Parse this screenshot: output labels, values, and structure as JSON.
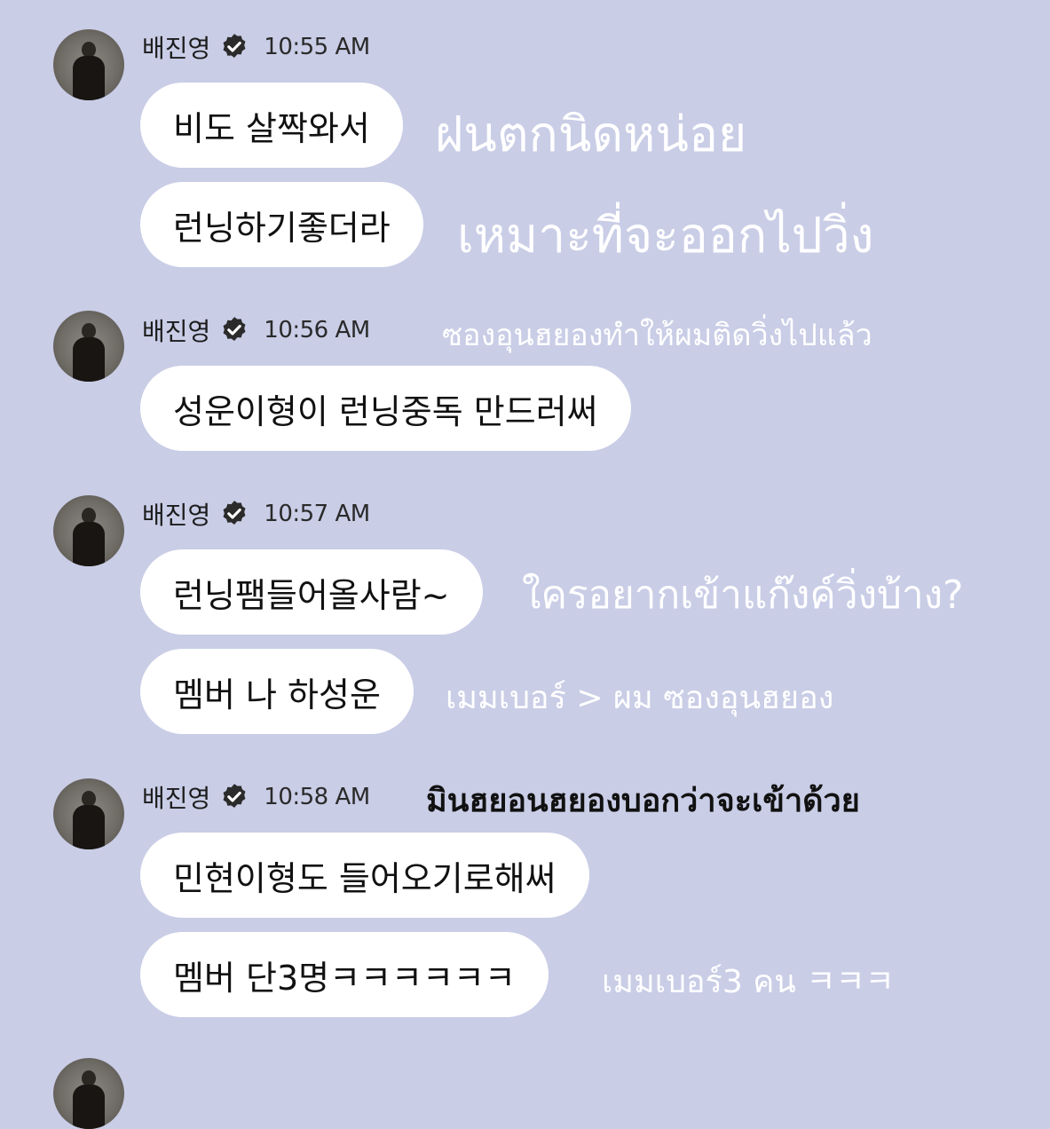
{
  "messages": [
    {
      "sender": "배진영",
      "time": "10:55 AM",
      "bubbles": [
        "비도 살짝와서",
        "런닝하기좋더라"
      ],
      "translations": [
        "ฝนตกนิดหน่อย",
        "เหมาะที่จะออกไปวิ่ง"
      ]
    },
    {
      "sender": "배진영",
      "time": "10:56 AM",
      "header_translation": "ซองอุนฮยองทำให้ผมติดวิ่งไปแล้ว",
      "bubbles": [
        "성운이형이 런닝중독 만드러써"
      ]
    },
    {
      "sender": "배진영",
      "time": "10:57 AM",
      "bubbles": [
        "런닝팸들어올사람~",
        "멤버 나 하성운"
      ],
      "translations": [
        "ใครอยากเข้าแก๊งค์วิ่งบ้าง?",
        "เมมเบอร์ > ผม ซองอุนฮยอง"
      ]
    },
    {
      "sender": "배진영",
      "time": "10:58 AM",
      "header_translation": "มินฮยอนฮยองบอกว่าจะเข้าด้วย",
      "bubbles": [
        "민현이형도 들어오기로해써",
        "멤버 단3명ㅋㅋㅋㅋㅋㅋ"
      ],
      "translations": [
        "",
        "เมมเบอร์3 คน ㅋㅋㅋ"
      ]
    }
  ],
  "colors": {
    "background": "#c9cde6",
    "bubble": "#ffffff",
    "verified_badge": "#2b2b2b"
  },
  "icons": {
    "verified": "verified-badge-icon"
  }
}
